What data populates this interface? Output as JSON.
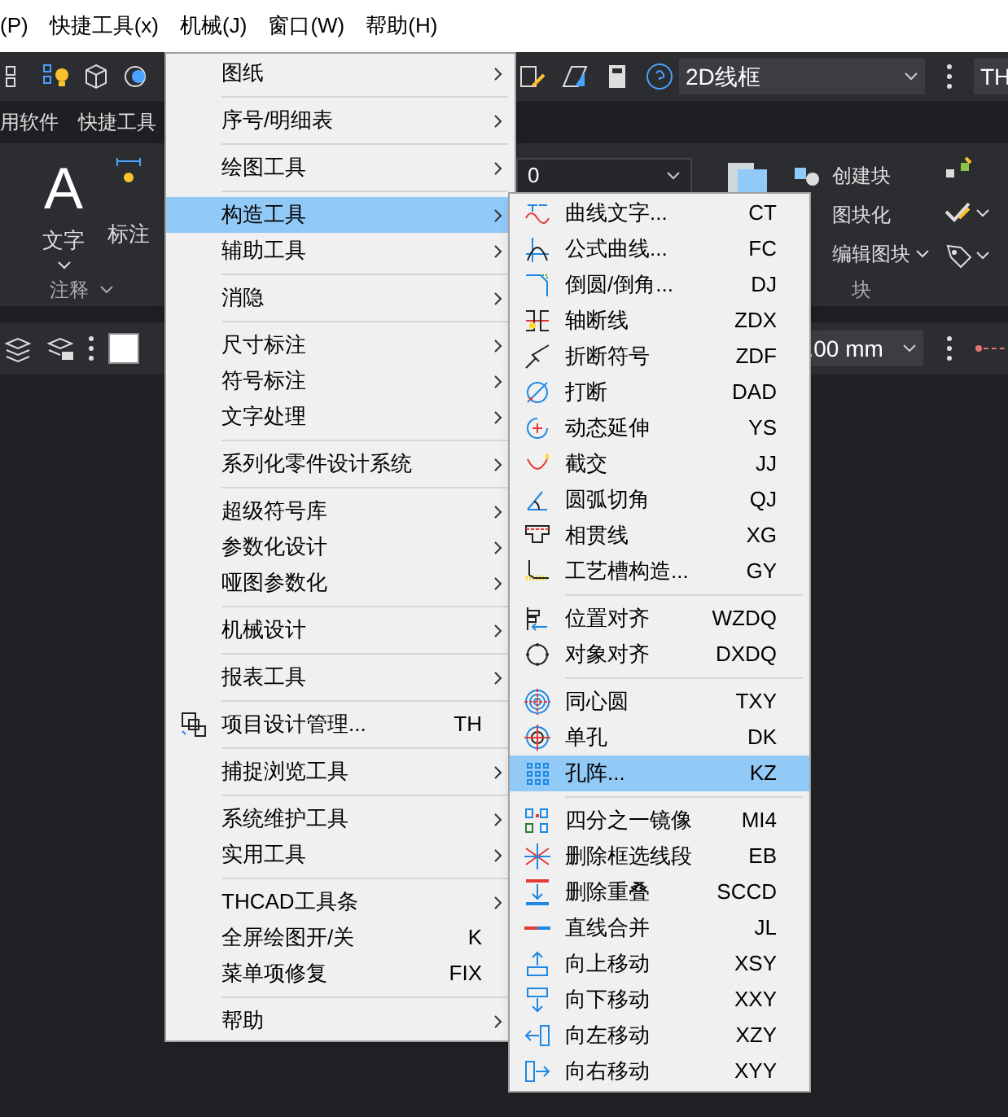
{
  "menubar": [
    {
      "label": "(P)"
    },
    {
      "label": "快捷工具(x)"
    },
    {
      "label": "机械(J)"
    },
    {
      "label": "窗口(W)"
    },
    {
      "label": "帮助(H)"
    }
  ],
  "toolbar": {
    "view_dropdown": "2D线框",
    "cut_field": "TH"
  },
  "tabs": [
    {
      "label": "用软件",
      "selected": false
    },
    {
      "label": "快捷工具",
      "selected": false
    }
  ],
  "ribbon": {
    "text_glyph": "A",
    "text_tool": "文字",
    "dimension_tool": "标注",
    "group_annotate": "注释",
    "layer_dropdown": "0",
    "create_block": "创建块",
    "blockify": "图块化",
    "edit_block": "编辑图块",
    "group_block": "块"
  },
  "properties_bar": {
    "unit_dropdown": ".00 mm"
  },
  "main_menu": {
    "groups": [
      {
        "items": [
          {
            "label": "图纸",
            "submenu": true,
            "selected": false,
            "kind": "plain"
          }
        ]
      },
      {
        "items": [
          {
            "label": "序号/明细表",
            "submenu": true,
            "selected": false,
            "kind": "plain"
          }
        ]
      },
      {
        "items": [
          {
            "label": "绘图工具",
            "submenu": true,
            "selected": false,
            "kind": "plain"
          }
        ]
      },
      {
        "items": [
          {
            "label": "构造工具",
            "submenu": true,
            "selected": true,
            "kind": "plain"
          },
          {
            "label": "辅助工具",
            "submenu": true,
            "selected": false,
            "kind": "plain"
          }
        ]
      },
      {
        "items": [
          {
            "label": "消隐",
            "submenu": true,
            "selected": false,
            "kind": "plain"
          }
        ]
      },
      {
        "items": [
          {
            "label": "尺寸标注",
            "submenu": true,
            "selected": false,
            "kind": "plain"
          },
          {
            "label": "符号标注",
            "submenu": true,
            "selected": false,
            "kind": "plain"
          },
          {
            "label": "文字处理",
            "submenu": true,
            "selected": false,
            "kind": "plain"
          }
        ]
      },
      {
        "items": [
          {
            "label": "系列化零件设计系统",
            "submenu": true,
            "selected": false,
            "kind": "plain"
          }
        ]
      },
      {
        "items": [
          {
            "label": "超级符号库",
            "submenu": true,
            "selected": false,
            "kind": "plain"
          },
          {
            "label": "参数化设计",
            "submenu": true,
            "selected": false,
            "kind": "plain"
          },
          {
            "label": "哑图参数化",
            "submenu": true,
            "selected": false,
            "kind": "plain"
          }
        ]
      },
      {
        "items": [
          {
            "label": "机械设计",
            "submenu": true,
            "selected": false,
            "kind": "plain"
          }
        ]
      },
      {
        "items": [
          {
            "label": "报表工具",
            "submenu": true,
            "selected": false,
            "kind": "plain"
          }
        ]
      },
      {
        "items": [
          {
            "label": "项目设计管理...",
            "shortcut": "TH",
            "submenu": false,
            "selected": false,
            "kind": "with_icon"
          }
        ]
      },
      {
        "items": [
          {
            "label": "捕捉浏览工具",
            "submenu": true,
            "selected": false,
            "kind": "plain"
          }
        ]
      },
      {
        "items": [
          {
            "label": "系统维护工具",
            "submenu": true,
            "selected": false,
            "kind": "plain"
          },
          {
            "label": "实用工具",
            "submenu": true,
            "selected": false,
            "kind": "plain"
          }
        ]
      },
      {
        "items": [
          {
            "label": "THCAD工具条",
            "submenu": true,
            "selected": false,
            "kind": "plain"
          },
          {
            "label": "全屏绘图开/关",
            "shortcut": "K",
            "submenu": false,
            "selected": false,
            "kind": "plain"
          },
          {
            "label": "菜单项修复",
            "shortcut": "FIX",
            "submenu": false,
            "selected": false,
            "kind": "plain"
          }
        ]
      },
      {
        "items": [
          {
            "label": "帮助",
            "submenu": true,
            "selected": false,
            "kind": "plain"
          }
        ]
      }
    ]
  },
  "submenu": {
    "groups": [
      {
        "items": [
          {
            "label": "曲线文字...",
            "shortcut": "CT",
            "selected": false
          },
          {
            "label": "公式曲线...",
            "shortcut": "FC",
            "selected": false
          },
          {
            "label": "倒圆/倒角...",
            "shortcut": "DJ",
            "selected": false
          },
          {
            "label": "轴断线",
            "shortcut": "ZDX",
            "selected": false
          },
          {
            "label": "折断符号",
            "shortcut": "ZDF",
            "selected": false
          },
          {
            "label": "打断",
            "shortcut": "DAD",
            "selected": false
          },
          {
            "label": "动态延伸",
            "shortcut": "YS",
            "selected": false
          },
          {
            "label": "截交",
            "shortcut": "JJ",
            "selected": false
          },
          {
            "label": "圆弧切角",
            "shortcut": "QJ",
            "selected": false
          },
          {
            "label": "相贯线",
            "shortcut": "XG",
            "selected": false
          },
          {
            "label": "工艺槽构造...",
            "shortcut": "GY",
            "selected": false
          }
        ]
      },
      {
        "items": [
          {
            "label": "位置对齐",
            "shortcut": "WZDQ",
            "selected": false
          },
          {
            "label": "对象对齐",
            "shortcut": "DXDQ",
            "selected": false
          }
        ]
      },
      {
        "items": [
          {
            "label": "同心圆",
            "shortcut": "TXY",
            "selected": false
          },
          {
            "label": "单孔",
            "shortcut": "DK",
            "selected": false
          },
          {
            "label": "孔阵...",
            "shortcut": "KZ",
            "selected": true
          }
        ]
      },
      {
        "items": [
          {
            "label": "四分之一镜像",
            "shortcut": "MI4",
            "selected": false
          },
          {
            "label": "删除框选线段",
            "shortcut": "EB",
            "selected": false
          },
          {
            "label": "删除重叠",
            "shortcut": "SCCD",
            "selected": false
          },
          {
            "label": "直线合并",
            "shortcut": "JL",
            "selected": false
          },
          {
            "label": "向上移动",
            "shortcut": "XSY",
            "selected": false
          },
          {
            "label": "向下移动",
            "shortcut": "XXY",
            "selected": false
          },
          {
            "label": "向左移动",
            "shortcut": "XZY",
            "selected": false
          },
          {
            "label": "向右移动",
            "shortcut": "XYY",
            "selected": false
          }
        ]
      }
    ]
  }
}
